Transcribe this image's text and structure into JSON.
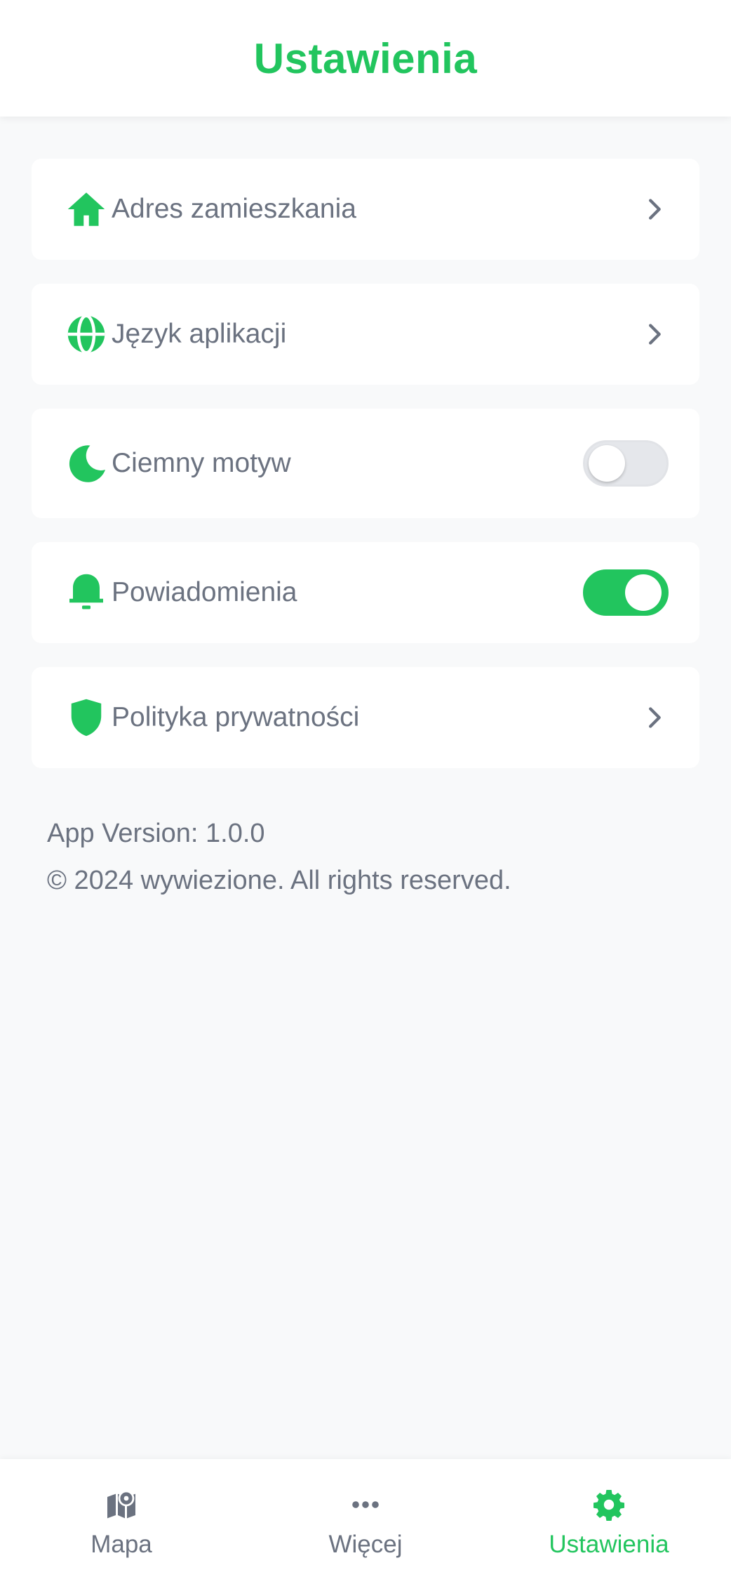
{
  "header": {
    "title": "Ustawienia"
  },
  "settings": {
    "address": {
      "label": "Adres zamieszkania",
      "icon": "home-icon"
    },
    "language": {
      "label": "Język aplikacji",
      "icon": "globe-icon"
    },
    "dark_mode": {
      "label": "Ciemny motyw",
      "icon": "moon-icon",
      "enabled": false
    },
    "notifications": {
      "label": "Powiadomienia",
      "icon": "bell-icon",
      "enabled": true
    },
    "privacy": {
      "label": "Polityka prywatności",
      "icon": "shield-icon"
    }
  },
  "footer": {
    "version": "App Version: 1.0.0",
    "copyright": "© 2024 wywiezione. All rights reserved."
  },
  "nav": {
    "items": [
      {
        "label": "Mapa",
        "icon": "map-icon",
        "active": false
      },
      {
        "label": "Więcej",
        "icon": "more-dots-icon",
        "active": false
      },
      {
        "label": "Ustawienia",
        "icon": "gear-icon",
        "active": true
      }
    ]
  },
  "colors": {
    "accent": "#22c55e",
    "text_muted": "#6b7280",
    "background": "#f8f9fa",
    "toggle_off": "#e5e7eb"
  }
}
